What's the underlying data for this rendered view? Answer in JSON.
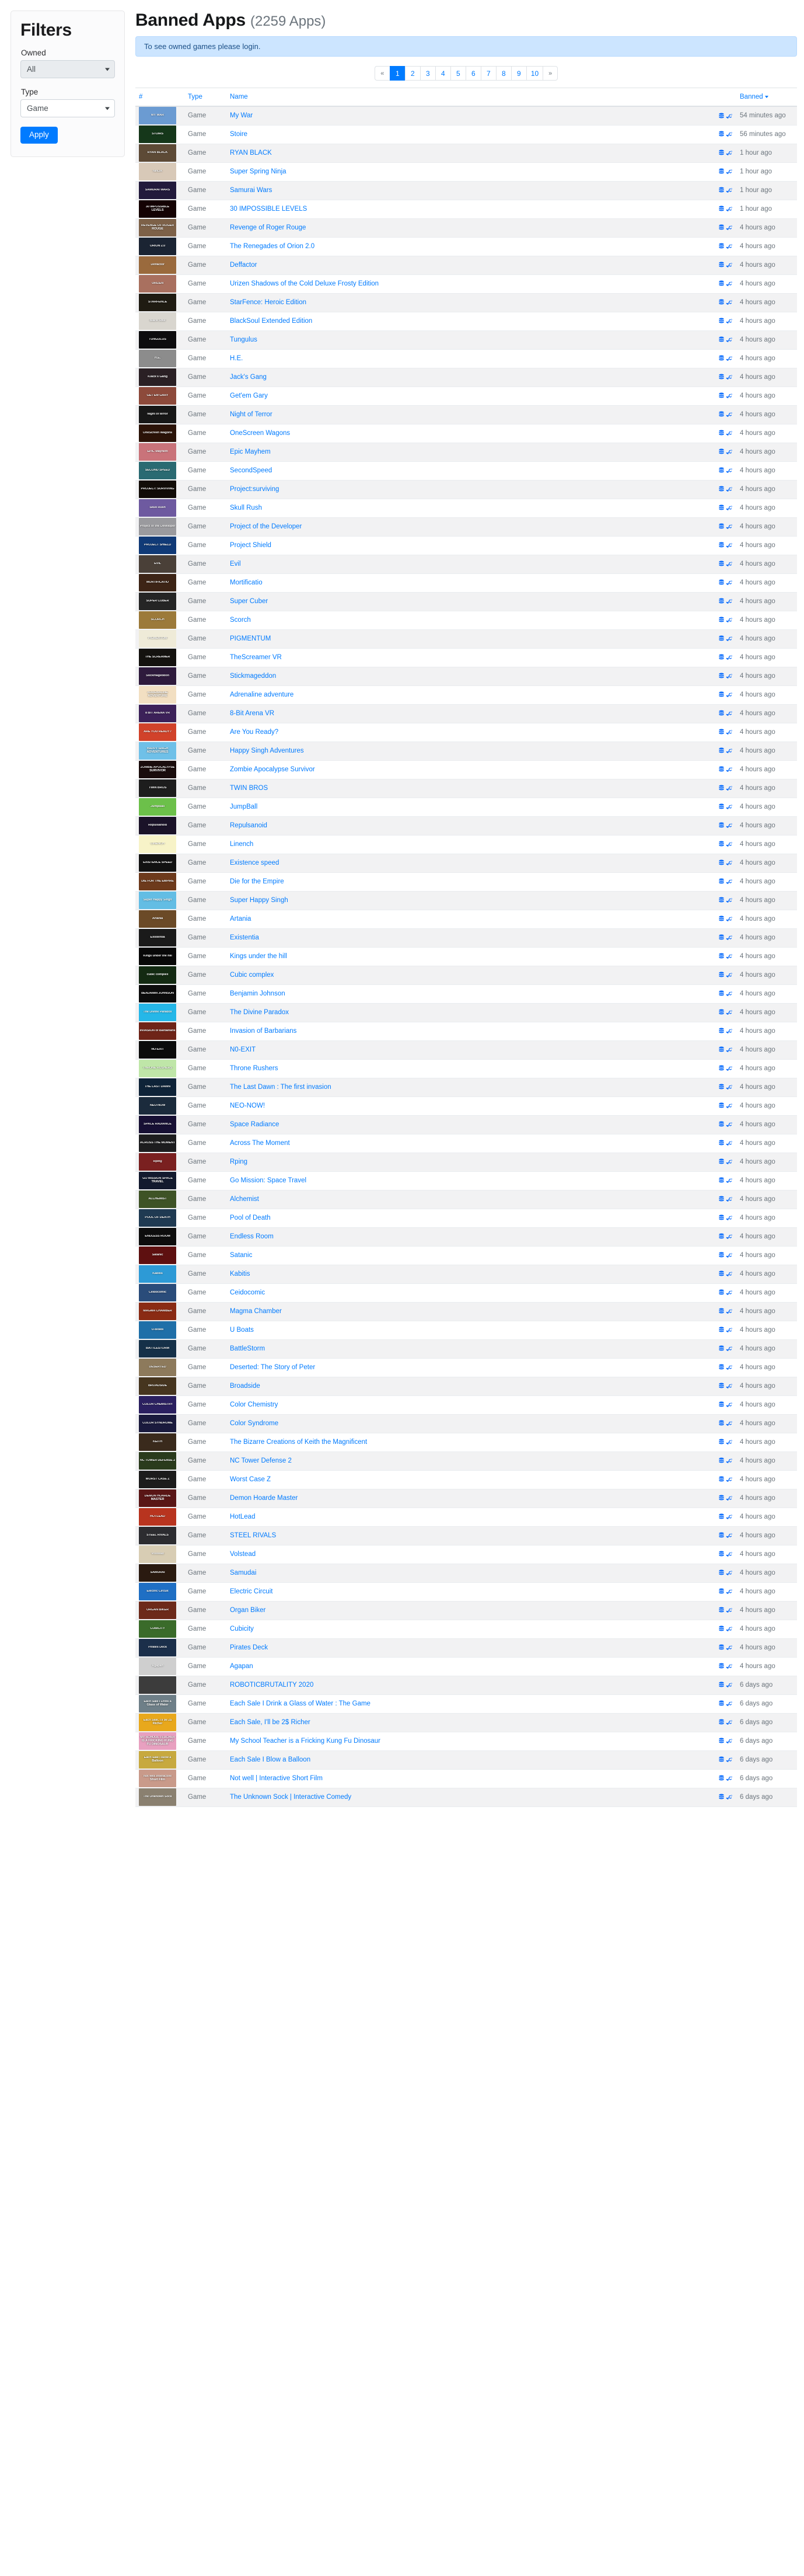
{
  "sidebar": {
    "title": "Filters",
    "owned_label": "Owned",
    "owned_value": "All",
    "owned_options": [
      "All"
    ],
    "type_label": "Type",
    "type_value": "Game",
    "type_options": [
      "Game"
    ],
    "apply_label": "Apply"
  },
  "main": {
    "title": "Banned Apps",
    "count": "(2259 Apps)",
    "alert": "To see owned games please login.",
    "pagination": {
      "prev": "«",
      "next": "»",
      "pages": [
        "1",
        "2",
        "3",
        "4",
        "5",
        "6",
        "7",
        "8",
        "9",
        "10"
      ],
      "active": "1"
    },
    "columns": {
      "num": "#",
      "type": "Type",
      "name": "Name",
      "icons": "",
      "banned": "Banned"
    },
    "icons": {
      "db": "database-icon",
      "steam": "steam-icon"
    },
    "rows": [
      {
        "type": "Game",
        "name": "My War",
        "banned": "54 minutes ago",
        "thumb": "MY WAR",
        "bg": "#6b9bd2"
      },
      {
        "type": "Game",
        "name": "Stoire",
        "banned": "56 minutes ago",
        "thumb": "STOIRS",
        "bg": "#15371a"
      },
      {
        "type": "Game",
        "name": "RYAN BLACK",
        "banned": "1 hour ago",
        "thumb": "RYAN BLACK",
        "bg": "#5d4a36"
      },
      {
        "type": "Game",
        "name": "Super Spring Ninja",
        "banned": "1 hour ago",
        "thumb": "NINJA",
        "bg": "#d8c9b8"
      },
      {
        "type": "Game",
        "name": "Samurai Wars",
        "banned": "1 hour ago",
        "thumb": "SAMURAI WARS",
        "bg": "#221a3c"
      },
      {
        "type": "Game",
        "name": "30 IMPOSSIBLE LEVELS",
        "banned": "1 hour ago",
        "thumb": "30 IMPOSSIBLE LEVELS",
        "bg": "#140203"
      },
      {
        "type": "Game",
        "name": "Revenge of Roger Rouge",
        "banned": "4 hours ago",
        "thumb": "REVENGE OF ROGER ROUGE",
        "bg": "#7d6148"
      },
      {
        "type": "Game",
        "name": "The Renegades of Orion 2.0",
        "banned": "4 hours ago",
        "thumb": "ORION 2.0",
        "bg": "#1b2433"
      },
      {
        "type": "Game",
        "name": "Deffactor",
        "banned": "4 hours ago",
        "thumb": "Deffactor",
        "bg": "#9a6a3d"
      },
      {
        "type": "Game",
        "name": "Urizen Shadows of the Cold Deluxe Frosty Edition",
        "banned": "4 hours ago",
        "thumb": "URIZEN",
        "bg": "#a9705f"
      },
      {
        "type": "Game",
        "name": "StarFence: Heroic Edition",
        "banned": "4 hours ago",
        "thumb": "STARFENCE",
        "bg": "#1f1b12"
      },
      {
        "type": "Game",
        "name": "BlackSoul Extended Edition",
        "banned": "4 hours ago",
        "thumb": "Black Soul",
        "bg": "#d9d6cf"
      },
      {
        "type": "Game",
        "name": "Tungulus",
        "banned": "4 hours ago",
        "thumb": "TUNGULUS",
        "bg": "#0c0c0e"
      },
      {
        "type": "Game",
        "name": "H.E.",
        "banned": "4 hours ago",
        "thumb": "H.E.",
        "bg": "#8c8c8c"
      },
      {
        "type": "Game",
        "name": "Jack's Gang",
        "banned": "4 hours ago",
        "thumb": "#Jack's Gang",
        "bg": "#2a2024"
      },
      {
        "type": "Game",
        "name": "Get'em Gary",
        "banned": "4 hours ago",
        "thumb": "GET'EM GARY",
        "bg": "#8d4a3b"
      },
      {
        "type": "Game",
        "name": "Night of Terror",
        "banned": "4 hours ago",
        "thumb": "Night of terror",
        "bg": "#171717"
      },
      {
        "type": "Game",
        "name": "OneScreen Wagons",
        "banned": "4 hours ago",
        "thumb": "OneScreen Wagons",
        "bg": "#2b1308"
      },
      {
        "type": "Game",
        "name": "Epic Mayhem",
        "banned": "4 hours ago",
        "thumb": "EPIC Mayhem",
        "bg": "#c9737a"
      },
      {
        "type": "Game",
        "name": "SecondSpeed",
        "banned": "4 hours ago",
        "thumb": "SECOND SPEED",
        "bg": "#2a6a72"
      },
      {
        "type": "Game",
        "name": "Project:surviving",
        "banned": "4 hours ago",
        "thumb": "PROJECT: SURVIVING",
        "bg": "#120d08"
      },
      {
        "type": "Game",
        "name": "Skull Rush",
        "banned": "4 hours ago",
        "thumb": "Skull Rush",
        "bg": "#6e5aa0"
      },
      {
        "type": "Game",
        "name": "Project of the Developer",
        "banned": "4 hours ago",
        "thumb": "Project of the Developer",
        "bg": "#9a9a9e"
      },
      {
        "type": "Game",
        "name": "Project Shield",
        "banned": "4 hours ago",
        "thumb": "PROJECT SHIELD",
        "bg": "#103a77"
      },
      {
        "type": "Game",
        "name": "Evil",
        "banned": "4 hours ago",
        "thumb": "EVIL",
        "bg": "#4a4038"
      },
      {
        "type": "Game",
        "name": "Mortificatio",
        "banned": "4 hours ago",
        "thumb": "MORTIFICATIO",
        "bg": "#3d2416"
      },
      {
        "type": "Game",
        "name": "Super Cuber",
        "banned": "4 hours ago",
        "thumb": "SUPER CUBER",
        "bg": "#252525"
      },
      {
        "type": "Game",
        "name": "Scorch",
        "banned": "4 hours ago",
        "thumb": "SCORCH",
        "bg": "#9c7a3a"
      },
      {
        "type": "Game",
        "name": "PIGMENTUM",
        "banned": "4 hours ago",
        "thumb": "PIGMENTUM",
        "bg": "#efebd8"
      },
      {
        "type": "Game",
        "name": "TheScreamer VR",
        "banned": "4 hours ago",
        "thumb": "THE SCREAMER",
        "bg": "#14120f"
      },
      {
        "type": "Game",
        "name": "Stickmageddon",
        "banned": "4 hours ago",
        "thumb": "Stickmageddon",
        "bg": "#2e1a3c"
      },
      {
        "type": "Game",
        "name": "Adrenaline adventure",
        "banned": "4 hours ago",
        "thumb": "ADRENALINE ADVENTURE",
        "bg": "#f2dfc2"
      },
      {
        "type": "Game",
        "name": "8-Bit Arena VR",
        "banned": "4 hours ago",
        "thumb": "8 BIT ARENA VR",
        "bg": "#3c2159"
      },
      {
        "type": "Game",
        "name": "Are You Ready?",
        "banned": "4 hours ago",
        "thumb": "ARE YOU READY?",
        "bg": "#d1422a"
      },
      {
        "type": "Game",
        "name": "Happy Singh Adventures",
        "banned": "4 hours ago",
        "thumb": "HAPPY SINGH ADVENTURES",
        "bg": "#6fc0e8"
      },
      {
        "type": "Game",
        "name": "Zombie Apocalypse Survivor",
        "banned": "4 hours ago",
        "thumb": "ZOMBIE APOCALYPSE SURVIVOR",
        "bg": "#1a0d0d"
      },
      {
        "type": "Game",
        "name": "TWIN BROS",
        "banned": "4 hours ago",
        "thumb": "TWIN BROS",
        "bg": "#1d1d1d"
      },
      {
        "type": "Game",
        "name": "JumpBall",
        "banned": "4 hours ago",
        "thumb": "JumpBall",
        "bg": "#6cc04a"
      },
      {
        "type": "Game",
        "name": "Repulsanoid",
        "banned": "4 hours ago",
        "thumb": "Repulsanoid",
        "bg": "#1a1228"
      },
      {
        "type": "Game",
        "name": "Linench",
        "banned": "4 hours ago",
        "thumb": "LINENCH",
        "bg": "#f7f3c8"
      },
      {
        "type": "Game",
        "name": "Existence speed",
        "banned": "4 hours ago",
        "thumb": "EXISTENCE SPEED",
        "bg": "#121212"
      },
      {
        "type": "Game",
        "name": "Die for the Empire",
        "banned": "4 hours ago",
        "thumb": "DIE FOR THE EMPIRE",
        "bg": "#6d3a1c"
      },
      {
        "type": "Game",
        "name": "Super Happy Singh",
        "banned": "4 hours ago",
        "thumb": "Super Happy Singh",
        "bg": "#63bde4"
      },
      {
        "type": "Game",
        "name": "Artania",
        "banned": "4 hours ago",
        "thumb": "Artania",
        "bg": "#6b4a27"
      },
      {
        "type": "Game",
        "name": "Existentia",
        "banned": "4 hours ago",
        "thumb": "Existentia",
        "bg": "#1a1a1a"
      },
      {
        "type": "Game",
        "name": "Kings under the hill",
        "banned": "4 hours ago",
        "thumb": "Kings under the hill",
        "bg": "#080808"
      },
      {
        "type": "Game",
        "name": "Cubic complex",
        "banned": "4 hours ago",
        "thumb": "cubic complex",
        "bg": "#132a12"
      },
      {
        "type": "Game",
        "name": "Benjamin Johnson",
        "banned": "4 hours ago",
        "thumb": "BENJAMIN JOHNSON",
        "bg": "#0c0c0c"
      },
      {
        "type": "Game",
        "name": "The Divine Paradox",
        "banned": "4 hours ago",
        "thumb": "The Divine Paradox",
        "bg": "#25b7e8"
      },
      {
        "type": "Game",
        "name": "Invasion of Barbarians",
        "banned": "4 hours ago",
        "thumb": "INVASION of Barbarians",
        "bg": "#6e2418"
      },
      {
        "type": "Game",
        "name": "N0-EXIT",
        "banned": "4 hours ago",
        "thumb": "NO-EXIT",
        "bg": "#0b0b0b"
      },
      {
        "type": "Game",
        "name": "Throne Rushers",
        "banned": "4 hours ago",
        "thumb": "THRONE RUSHERS",
        "bg": "#bfe6a8"
      },
      {
        "type": "Game",
        "name": "The Last Dawn : The first invasion",
        "banned": "4 hours ago",
        "thumb": "THE LAST DAWN",
        "bg": "#0e2338"
      },
      {
        "type": "Game",
        "name": "NEO-NOW!",
        "banned": "4 hours ago",
        "thumb": "NEO-NOW",
        "bg": "#1b2b3c"
      },
      {
        "type": "Game",
        "name": "Space Radiance",
        "banned": "4 hours ago",
        "thumb": "SPACE RADIANCE",
        "bg": "#171034"
      },
      {
        "type": "Game",
        "name": "Across The Moment",
        "banned": "4 hours ago",
        "thumb": "ACROSS THE MOMENT",
        "bg": "#1d1d1f"
      },
      {
        "type": "Game",
        "name": "Rping",
        "banned": "4 hours ago",
        "thumb": "Rping",
        "bg": "#7a2020"
      },
      {
        "type": "Game",
        "name": "Go Mission: Space Travel",
        "banned": "4 hours ago",
        "thumb": "GO MISSION SPACE TRAVEL",
        "bg": "#131a2e"
      },
      {
        "type": "Game",
        "name": "Alchemist",
        "banned": "4 hours ago",
        "thumb": "ALCHEMIST",
        "bg": "#3e5326"
      },
      {
        "type": "Game",
        "name": "Pool of Death",
        "banned": "4 hours ago",
        "thumb": "POOL OF DEATH",
        "bg": "#1f3a52"
      },
      {
        "type": "Game",
        "name": "Endless Room",
        "banned": "4 hours ago",
        "thumb": "ENDLESS ROOM",
        "bg": "#0d0d0d"
      },
      {
        "type": "Game",
        "name": "Satanic",
        "banned": "4 hours ago",
        "thumb": "Satanic",
        "bg": "#5e1010"
      },
      {
        "type": "Game",
        "name": "Kabitis",
        "banned": "4 hours ago",
        "thumb": "Kabitis",
        "bg": "#2d9ad6"
      },
      {
        "type": "Game",
        "name": "Ceidocomic",
        "banned": "4 hours ago",
        "thumb": "Ceidocomic",
        "bg": "#2a4c7a"
      },
      {
        "type": "Game",
        "name": "Magma Chamber",
        "banned": "4 hours ago",
        "thumb": "MAGMA CHAMBER",
        "bg": "#8a2b14"
      },
      {
        "type": "Game",
        "name": "U Boats",
        "banned": "4 hours ago",
        "thumb": "U-Boats",
        "bg": "#1f6fa8"
      },
      {
        "type": "Game",
        "name": "BattleStorm",
        "banned": "4 hours ago",
        "thumb": "BATTLESTORM",
        "bg": "#153048"
      },
      {
        "type": "Game",
        "name": "Deserted: The Story of Peter",
        "banned": "4 hours ago",
        "thumb": "DESERTED",
        "bg": "#8d7a5c"
      },
      {
        "type": "Game",
        "name": "Broadside",
        "banned": "4 hours ago",
        "thumb": "BROADSIDE",
        "bg": "#46351f"
      },
      {
        "type": "Game",
        "name": "Color Chemistry",
        "banned": "4 hours ago",
        "thumb": "COLOR CHEMISTRY",
        "bg": "#2b2060"
      },
      {
        "type": "Game",
        "name": "Color Syndrome",
        "banned": "4 hours ago",
        "thumb": "COLOR SYNDROME",
        "bg": "#1a1a3d"
      },
      {
        "type": "Game",
        "name": "The Bizarre Creations of Keith the Magnificent",
        "banned": "4 hours ago",
        "thumb": "KEITH",
        "bg": "#3a2a1c"
      },
      {
        "type": "Game",
        "name": "NC Tower Defense 2",
        "banned": "4 hours ago",
        "thumb": "NC TOWER DEFENSE 2",
        "bg": "#2a3b1c"
      },
      {
        "type": "Game",
        "name": "Worst Case Z",
        "banned": "4 hours ago",
        "thumb": "WORST CASE Z",
        "bg": "#1c1c1c"
      },
      {
        "type": "Game",
        "name": "Demon Hoarde Master",
        "banned": "4 hours ago",
        "thumb": "DEMON HOARDE MASTER",
        "bg": "#591616"
      },
      {
        "type": "Game",
        "name": "HotLead",
        "banned": "4 hours ago",
        "thumb": "HOTLEAD",
        "bg": "#b8341f"
      },
      {
        "type": "Game",
        "name": "STEEL RIVALS",
        "banned": "4 hours ago",
        "thumb": "STEEL RIVALS",
        "bg": "#2c2c30"
      },
      {
        "type": "Game",
        "name": "Volstead",
        "banned": "4 hours ago",
        "thumb": "Volstead",
        "bg": "#d8cdb4"
      },
      {
        "type": "Game",
        "name": "Samudai",
        "banned": "4 hours ago",
        "thumb": "SAMURAI",
        "bg": "#2a1a10"
      },
      {
        "type": "Game",
        "name": "Electric Circuit",
        "banned": "4 hours ago",
        "thumb": "Electric Circuit",
        "bg": "#1f6fc4"
      },
      {
        "type": "Game",
        "name": "Organ Biker",
        "banned": "4 hours ago",
        "thumb": "ORGAN BIKER",
        "bg": "#6d2a1a"
      },
      {
        "type": "Game",
        "name": "Cubicity",
        "banned": "4 hours ago",
        "thumb": "CUBICITY",
        "bg": "#3a6b2a"
      },
      {
        "type": "Game",
        "name": "Pirates Deck",
        "banned": "4 hours ago",
        "thumb": "Pirates Deck",
        "bg": "#1b2f4a"
      },
      {
        "type": "Game",
        "name": "Agapan",
        "banned": "4 hours ago",
        "thumb": "Agapan",
        "bg": "#cfcfcf"
      },
      {
        "type": "Game",
        "name": "ROBOTICBRUTALITY 2020",
        "banned": "6 days ago",
        "thumb": "",
        "bg": "#3c3c3c"
      },
      {
        "type": "Game",
        "name": "Each Sale I Drink a Glass of Water : The Game",
        "banned": "6 days ago",
        "thumb": "Each Sale I Drink a Glass of Water",
        "bg": "#6e7f88"
      },
      {
        "type": "Game",
        "name": "Each Sale, I'll be 2$ Richer",
        "banned": "6 days ago",
        "thumb": "Each Sale, I'll be 2$ Richer",
        "bg": "#e8a81c"
      },
      {
        "type": "Game",
        "name": "My School Teacher is a Fricking Kung Fu Dinosaur",
        "banned": "6 days ago",
        "thumb": "MY SCHOOL TEACHER IS A FRICKING KUNG FU DINOSAUR",
        "bg": "#e8a0c0"
      },
      {
        "type": "Game",
        "name": "Each Sale I Blow a Balloon",
        "banned": "6 days ago",
        "thumb": "Each Sale I Blow a Balloon",
        "bg": "#c7a93f"
      },
      {
        "type": "Game",
        "name": "Not well | Interactive Short Film",
        "banned": "6 days ago",
        "thumb": "Not well Interactive Short Film",
        "bg": "#c99a8a"
      },
      {
        "type": "Game",
        "name": "The Unknown Sock | Interactive Comedy",
        "banned": "6 days ago",
        "thumb": "The Unknown Sock",
        "bg": "#8a8070"
      }
    ]
  }
}
